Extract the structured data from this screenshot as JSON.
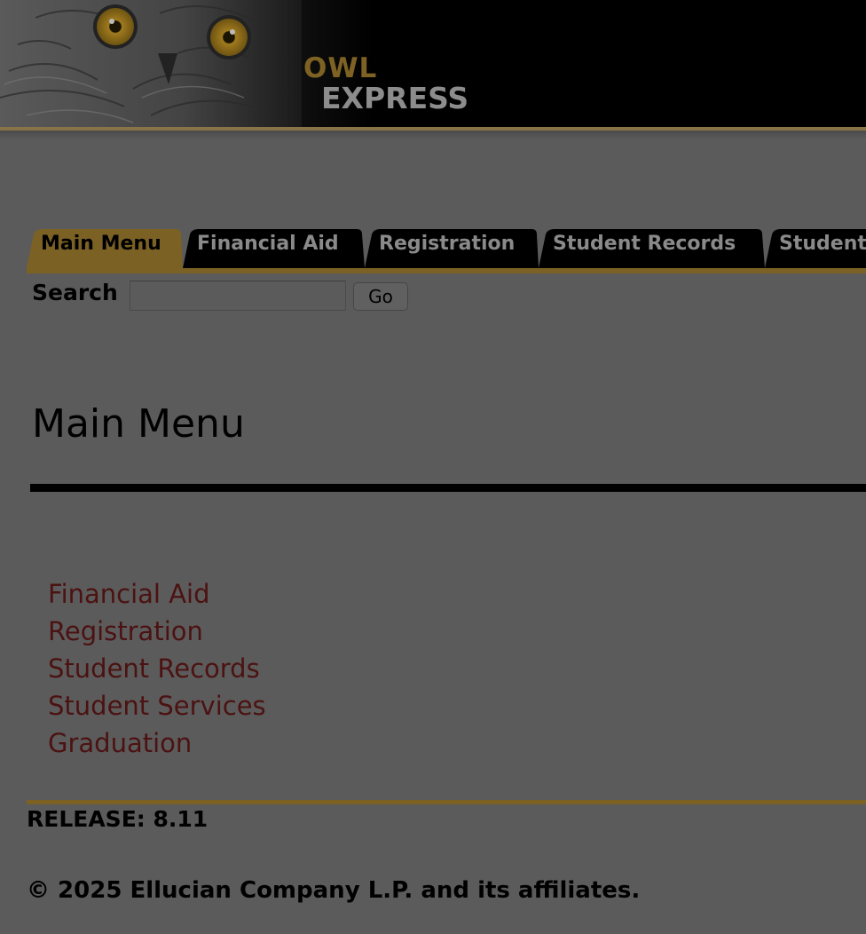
{
  "header": {
    "logo_line1": "OWL",
    "logo_line2": "EXPRESS",
    "mascot_icon": "owl-icon",
    "brand_gold": "#7c6124"
  },
  "tabs": [
    {
      "label": "Main Menu",
      "active": true
    },
    {
      "label": "Financial Aid",
      "active": false
    },
    {
      "label": "Registration",
      "active": false
    },
    {
      "label": "Student Records",
      "active": false
    },
    {
      "label": "Student",
      "active": false
    }
  ],
  "search": {
    "label": "Search",
    "value": "",
    "button_label": "Go"
  },
  "main": {
    "title": "Main Menu",
    "links": [
      {
        "label": "Financial Aid"
      },
      {
        "label": "Registration"
      },
      {
        "label": "Student Records"
      },
      {
        "label": "Student Services"
      },
      {
        "label": "Graduation"
      }
    ],
    "link_color": "#4c1212"
  },
  "footer": {
    "release": "RELEASE: 8.11",
    "copyright": "© 2025 Ellucian Company L.P. and its affiliates."
  }
}
